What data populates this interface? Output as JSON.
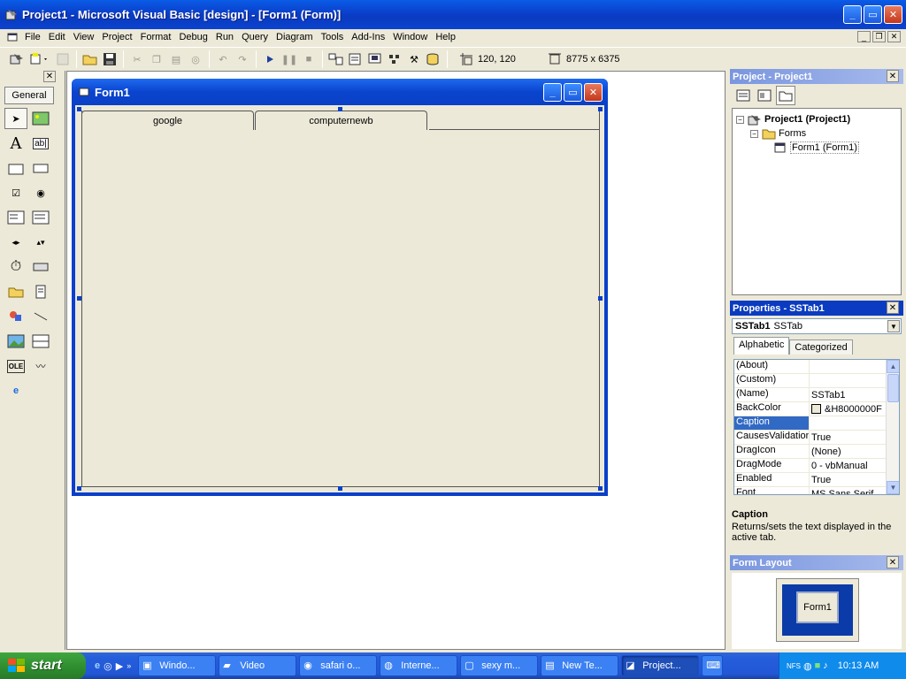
{
  "window": {
    "title": "Project1 - Microsoft Visual Basic [design] - [Form1 (Form)]"
  },
  "menu": [
    "File",
    "Edit",
    "View",
    "Project",
    "Format",
    "Debug",
    "Run",
    "Query",
    "Diagram",
    "Tools",
    "Add-Ins",
    "Window",
    "Help"
  ],
  "toolbar": {
    "position": "120, 120",
    "size": "8775 x 6375"
  },
  "toolbox": {
    "tab_label": "General"
  },
  "form": {
    "title": "Form1",
    "tabs": [
      "google",
      "computernewb"
    ]
  },
  "project_explorer": {
    "title": "Project - Project1",
    "tree": {
      "project": "Project1 (Project1)",
      "folder": "Forms",
      "item": "Form1 (Form1)"
    }
  },
  "properties": {
    "title": "Properties - SSTab1",
    "object_name": "SSTab1",
    "object_type": "SSTab",
    "tabs": [
      "Alphabetic",
      "Categorized"
    ],
    "rows": [
      {
        "name": "(About)",
        "value": ""
      },
      {
        "name": "(Custom)",
        "value": ""
      },
      {
        "name": "(Name)",
        "value": "SSTab1"
      },
      {
        "name": "BackColor",
        "value": "&H8000000F"
      },
      {
        "name": "Caption",
        "value": ""
      },
      {
        "name": "CausesValidation",
        "value": "True"
      },
      {
        "name": "DragIcon",
        "value": "(None)"
      },
      {
        "name": "DragMode",
        "value": "0 - vbManual"
      },
      {
        "name": "Enabled",
        "value": "True"
      },
      {
        "name": "Font",
        "value": "MS Sans Serif"
      }
    ],
    "selected_row": "Caption",
    "desc_title": "Caption",
    "desc_text": "Returns/sets the text displayed in the active tab."
  },
  "form_layout": {
    "title": "Form Layout",
    "mini_form": "Form1"
  },
  "taskbar": {
    "start": "start",
    "tasks": [
      "Windo...",
      "Video",
      "safari o...",
      "Interne...",
      "sexy m...",
      "New Te...",
      "Project..."
    ],
    "active_task": "Project...",
    "clock": "10:13 AM"
  },
  "colors": {
    "xp_blue": "#0A3FCB",
    "selection": "#316AC5",
    "face": "#ECE9D8"
  }
}
